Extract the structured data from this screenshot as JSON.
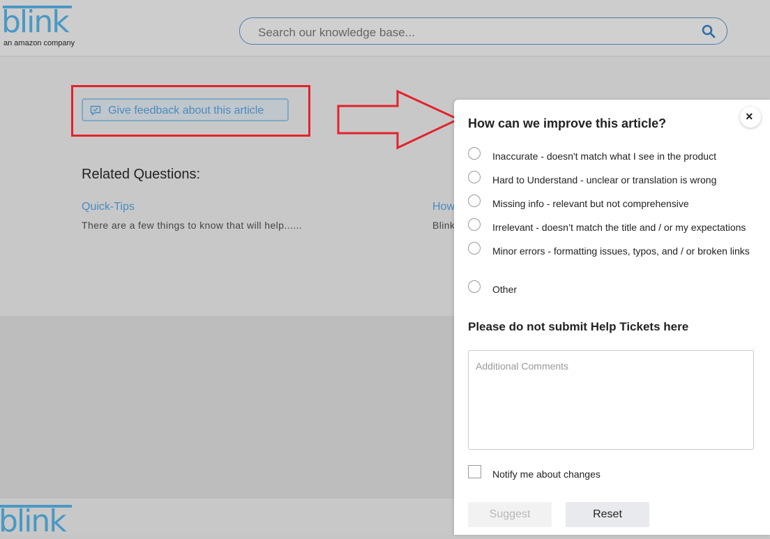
{
  "header": {
    "logo_text": "blink",
    "logo_tagline": "an amazon company",
    "search_placeholder": "Search our knowledge base..."
  },
  "feedback_button": {
    "label": "Give feedback about this article"
  },
  "related": {
    "heading": "Related Questions:",
    "items": [
      {
        "title": "Quick-Tips",
        "desc": "There are a few things to know that will help......"
      },
      {
        "title": "How",
        "desc": "Blink"
      }
    ]
  },
  "panel": {
    "title": "How can we improve this article?",
    "close_glyph": "×",
    "options": [
      "Inaccurate - doesn't match what I see in the product",
      "Hard to Understand - unclear or translation is wrong",
      "Missing info - relevant but not comprehensive",
      "Irrelevant - doesn’t match the title and / or my expectations",
      "Minor errors - formatting issues, typos, and / or broken links",
      "Other"
    ],
    "subheading": "Please do not submit Help Tickets here",
    "comments_placeholder": "Additional Comments",
    "notify_label": "Notify me about changes",
    "suggest_label": "Suggest",
    "reset_label": "Reset"
  },
  "footer": {
    "logo_text": "blink"
  },
  "colors": {
    "brand": "#4a98c4",
    "link": "#4a8bbd",
    "annotation": "#e3222b",
    "overlay": "#c6c6c6"
  }
}
